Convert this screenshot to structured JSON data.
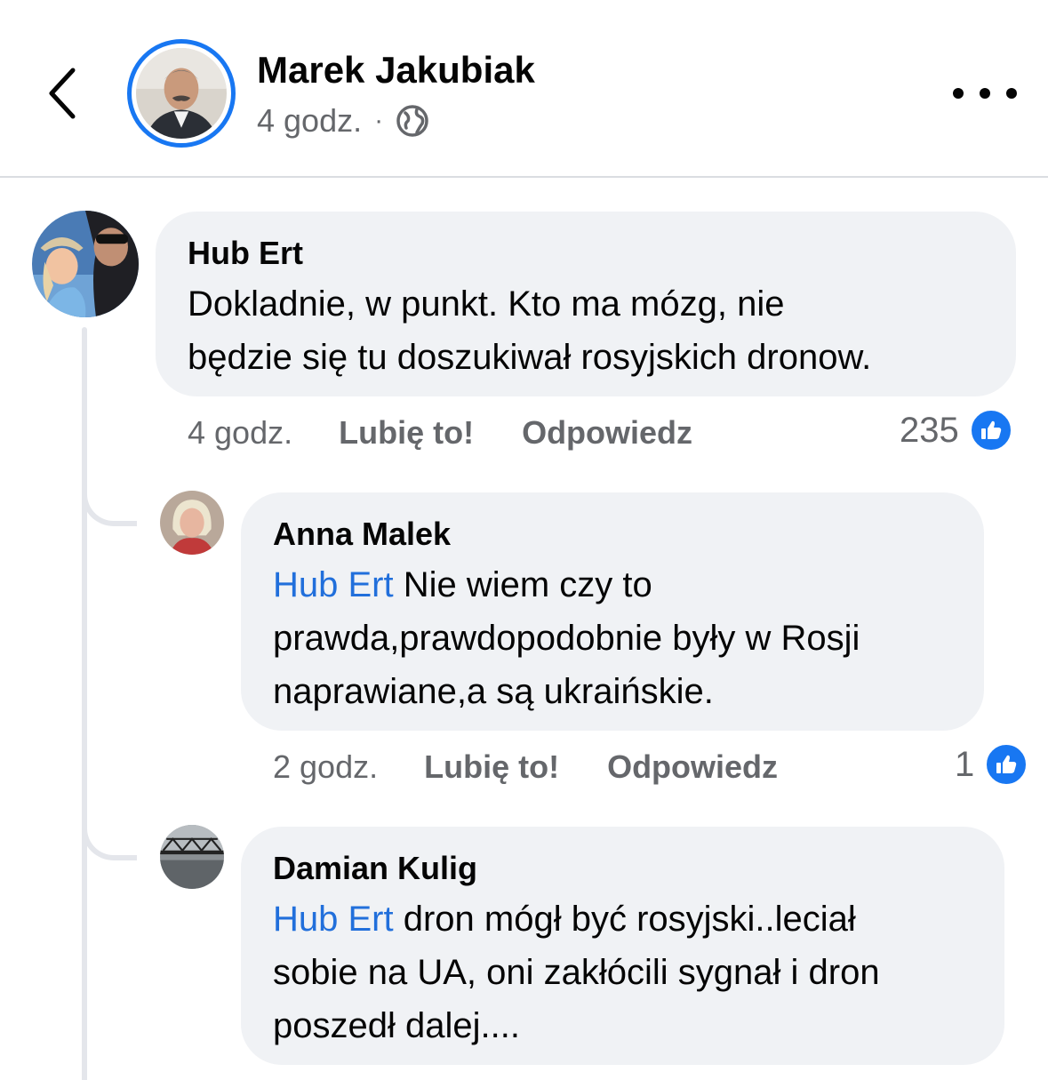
{
  "header": {
    "author_name": "Marek Jakubiak",
    "time": "4 godz.",
    "separator": "·",
    "icons": {
      "back": "chevron-left-icon",
      "privacy": "globe-icon",
      "more": "more-horizontal-icon"
    }
  },
  "colors": {
    "accent": "#1877f2",
    "mention": "#216fdb",
    "bubble": "#f0f2f5",
    "meta_text": "#65676b",
    "thread_line": "#e4e6eb"
  },
  "comments": [
    {
      "author": "Hub Ert",
      "mention": "",
      "text_line1": "Dokladnie, w punkt. Kto ma mózg, nie",
      "text_line2": "będzie się tu doszukiwał rosyjskich dronow.",
      "text_line3": "",
      "time": "4 godz.",
      "like_label": "Lubię to!",
      "reply_label": "Odpowiedz",
      "like_count": "235"
    },
    {
      "author": "Anna Malek",
      "mention": "Hub Ert",
      "text_line1": " Nie wiem czy to",
      "text_line2": "prawda,prawdopodobnie były w Rosji",
      "text_line3": "naprawiane,a są ukraińskie.",
      "time": "2 godz.",
      "like_label": "Lubię to!",
      "reply_label": "Odpowiedz",
      "like_count": "1"
    },
    {
      "author": "Damian Kulig",
      "mention": "Hub Ert",
      "text_line1": " dron mógł być rosyjski..leciał",
      "text_line2": "sobie na UA, oni zakłócili sygnał i dron",
      "text_line3": "poszedł dalej...."
    }
  ]
}
